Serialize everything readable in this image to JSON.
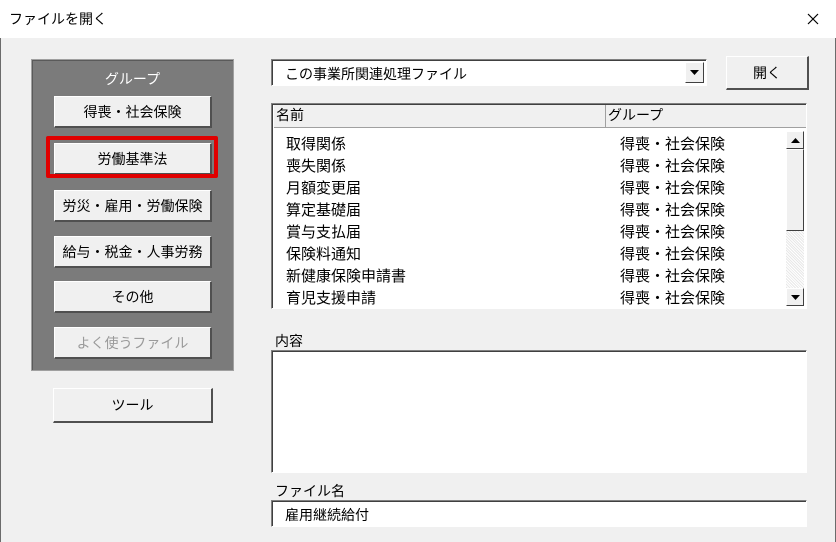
{
  "window": {
    "title": "ファイルを開く",
    "close_icon": "close-icon"
  },
  "group_panel": {
    "title": "グループ",
    "buttons": [
      {
        "label": "得喪・社会保険",
        "enabled": true
      },
      {
        "label": "労働基準法",
        "enabled": true,
        "highlighted": true
      },
      {
        "label": "労災・雇用・労働保険",
        "enabled": true
      },
      {
        "label": "給与・税金・人事労務",
        "enabled": true
      },
      {
        "label": "その他",
        "enabled": true
      },
      {
        "label": "よく使うファイル",
        "enabled": false
      }
    ],
    "highlight_color": "#e00000"
  },
  "tool_button": {
    "label": "ツール"
  },
  "combo": {
    "value": "この事業所関連処理ファイル",
    "arrow_icon": "chevron-down-icon"
  },
  "open_button": {
    "label": "開く"
  },
  "file_list": {
    "headers": {
      "name": "名前",
      "group": "グループ"
    },
    "rows": [
      {
        "name": "取得関係",
        "group": "得喪・社会保険"
      },
      {
        "name": "喪失関係",
        "group": "得喪・社会保険"
      },
      {
        "name": "月額変更届",
        "group": "得喪・社会保険"
      },
      {
        "name": "算定基礎届",
        "group": "得喪・社会保険"
      },
      {
        "name": "賞与支払届",
        "group": "得喪・社会保険"
      },
      {
        "name": "保険料通知",
        "group": "得喪・社会保険"
      },
      {
        "name": "新健康保険申請書",
        "group": "得喪・社会保険"
      },
      {
        "name": "育児支援申請",
        "group": "得喪・社会保険"
      }
    ]
  },
  "content": {
    "label": "内容",
    "value": ""
  },
  "filename": {
    "label": "ファイル名",
    "value": "雇用継続給付"
  }
}
